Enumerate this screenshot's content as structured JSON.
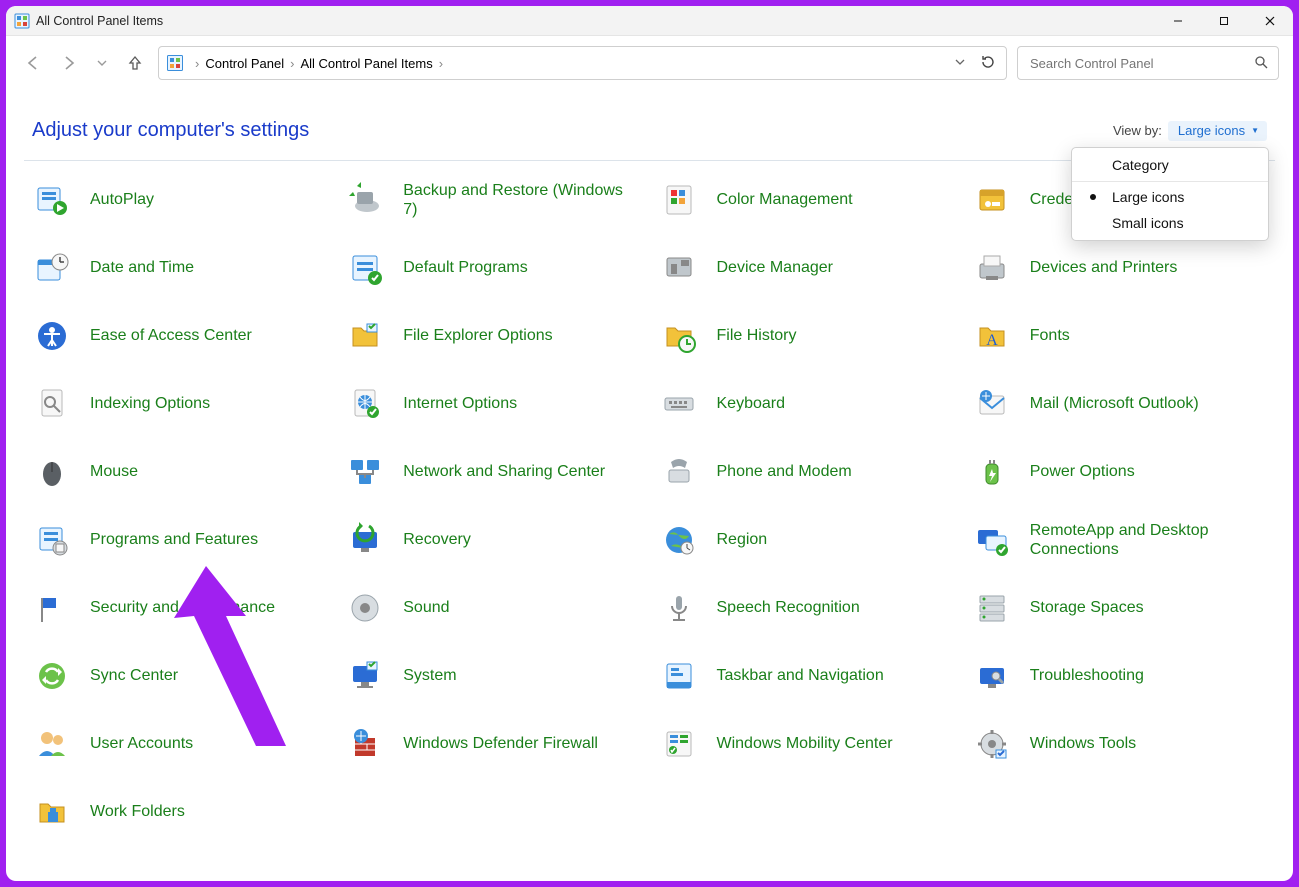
{
  "window": {
    "title": "All Control Panel Items"
  },
  "breadcrumb": {
    "root": "Control Panel",
    "current": "All Control Panel Items"
  },
  "search": {
    "placeholder": "Search Control Panel"
  },
  "header": {
    "title": "Adjust your computer's settings"
  },
  "viewby": {
    "label": "View by:",
    "value": "Large icons",
    "options": [
      "Category",
      "Large icons",
      "Small icons"
    ],
    "selected_index": 1
  },
  "items": [
    {
      "label": "AutoPlay",
      "icon": "autoplay-icon"
    },
    {
      "label": "Backup and Restore (Windows 7)",
      "icon": "backup-icon"
    },
    {
      "label": "Color Management",
      "icon": "color-management-icon"
    },
    {
      "label": "Credential Manager",
      "icon": "credential-manager-icon"
    },
    {
      "label": "Date and Time",
      "icon": "date-time-icon"
    },
    {
      "label": "Default Programs",
      "icon": "default-programs-icon"
    },
    {
      "label": "Device Manager",
      "icon": "device-manager-icon"
    },
    {
      "label": "Devices and Printers",
      "icon": "devices-printers-icon"
    },
    {
      "label": "Ease of Access Center",
      "icon": "ease-of-access-icon"
    },
    {
      "label": "File Explorer Options",
      "icon": "file-explorer-options-icon"
    },
    {
      "label": "File History",
      "icon": "file-history-icon"
    },
    {
      "label": "Fonts",
      "icon": "fonts-icon"
    },
    {
      "label": "Indexing Options",
      "icon": "indexing-options-icon"
    },
    {
      "label": "Internet Options",
      "icon": "internet-options-icon"
    },
    {
      "label": "Keyboard",
      "icon": "keyboard-icon"
    },
    {
      "label": "Mail (Microsoft Outlook)",
      "icon": "mail-icon"
    },
    {
      "label": "Mouse",
      "icon": "mouse-icon"
    },
    {
      "label": "Network and Sharing Center",
      "icon": "network-icon"
    },
    {
      "label": "Phone and Modem",
      "icon": "phone-modem-icon"
    },
    {
      "label": "Power Options",
      "icon": "power-options-icon"
    },
    {
      "label": "Programs and Features",
      "icon": "programs-features-icon"
    },
    {
      "label": "Recovery",
      "icon": "recovery-icon"
    },
    {
      "label": "Region",
      "icon": "region-icon"
    },
    {
      "label": "RemoteApp and Desktop Connections",
      "icon": "remoteapp-icon"
    },
    {
      "label": "Security and Maintenance",
      "icon": "security-maintenance-icon"
    },
    {
      "label": "Sound",
      "icon": "sound-icon"
    },
    {
      "label": "Speech Recognition",
      "icon": "speech-recognition-icon"
    },
    {
      "label": "Storage Spaces",
      "icon": "storage-spaces-icon"
    },
    {
      "label": "Sync Center",
      "icon": "sync-center-icon"
    },
    {
      "label": "System",
      "icon": "system-icon"
    },
    {
      "label": "Taskbar and Navigation",
      "icon": "taskbar-icon"
    },
    {
      "label": "Troubleshooting",
      "icon": "troubleshooting-icon"
    },
    {
      "label": "User Accounts",
      "icon": "user-accounts-icon"
    },
    {
      "label": "Windows Defender Firewall",
      "icon": "firewall-icon"
    },
    {
      "label": "Windows Mobility Center",
      "icon": "mobility-center-icon"
    },
    {
      "label": "Windows Tools",
      "icon": "windows-tools-icon"
    },
    {
      "label": "Work Folders",
      "icon": "work-folders-icon"
    }
  ],
  "colors": {
    "link_green": "#1a7f1a",
    "heading_blue": "#1a3bca",
    "accent_blue_bg": "#eaf3fc",
    "accent_blue_fg": "#1f6fd0",
    "arrow_purple": "#a020f0"
  }
}
